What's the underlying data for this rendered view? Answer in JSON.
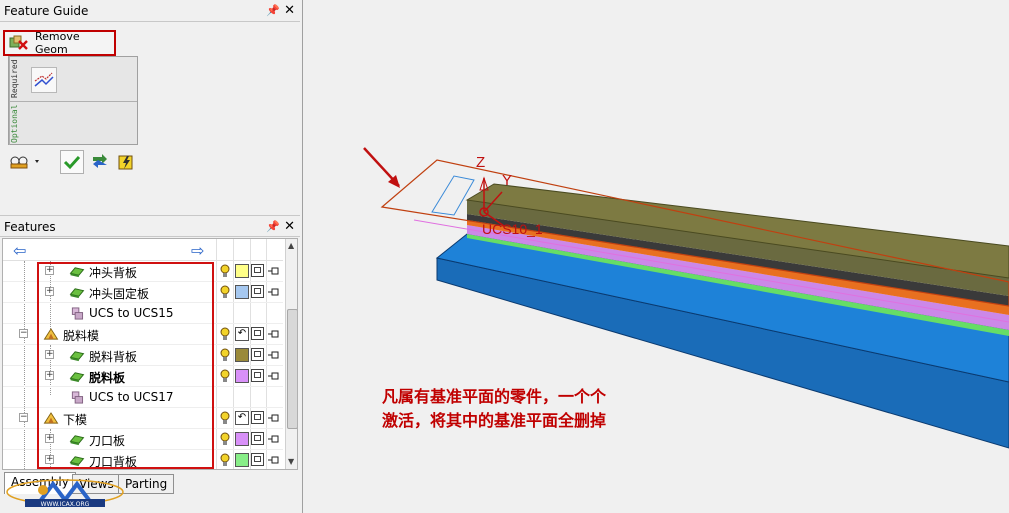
{
  "feature_guide": {
    "title": "Feature Guide",
    "pin_glyph": "Ⅰ",
    "close_glyph": "×",
    "remove_geom_label": "Remove Geom",
    "required_label": "Required",
    "optional_label": "Optional"
  },
  "features": {
    "title": "Features",
    "rows": [
      {
        "label": "冲头背板",
        "indent": 1,
        "icon": "part-icon",
        "color": "#ffff88",
        "bold": false,
        "bulb": "#f2d32a"
      },
      {
        "label": "冲头固定板",
        "indent": 1,
        "icon": "part-icon",
        "color": "#a6c8f0",
        "bold": false,
        "bulb": "#f2d32a"
      },
      {
        "label": "UCS to UCS15",
        "indent": 2,
        "icon": "ucs-icon",
        "color": null,
        "bold": false,
        "bulb": null
      },
      {
        "label": "脱料模",
        "indent": 0,
        "icon": "assembly-icon",
        "color": null,
        "bold": false,
        "bulb": "#f2d32a"
      },
      {
        "label": "脱料背板",
        "indent": 1,
        "icon": "part-icon",
        "color": "#9a8a3a",
        "bold": false,
        "bulb": "#f2d32a"
      },
      {
        "label": "脱料板",
        "indent": 1,
        "icon": "part-icon",
        "color": "#d890f8",
        "bold": true,
        "bulb": "#f2d32a"
      },
      {
        "label": "UCS to UCS17",
        "indent": 2,
        "icon": "ucs-icon",
        "color": null,
        "bold": false,
        "bulb": null
      },
      {
        "label": "下模",
        "indent": 0,
        "icon": "assembly-icon",
        "color": null,
        "bold": false,
        "bulb": "#f2d32a"
      },
      {
        "label": "刀口板",
        "indent": 1,
        "icon": "part-icon",
        "color": "#d890f8",
        "bold": false,
        "bulb": "#f2d32a"
      },
      {
        "label": "刀口背板",
        "indent": 1,
        "icon": "part-icon",
        "color": "#88ee88",
        "bold": false,
        "bulb": "#f2d32a"
      }
    ]
  },
  "tabs": {
    "assembly": "Assembly",
    "views": "Views",
    "parting": "Parting"
  },
  "logo_text": "WWW.ICAX.ORG",
  "viewport": {
    "axis_z": "Z",
    "axis_y": "Y",
    "ucs_label": "UCS10_1",
    "annotation_line1": "凡属有基准平面的零件，一个个",
    "annotation_line2": "激活，将其中的基准平面全删掉"
  }
}
